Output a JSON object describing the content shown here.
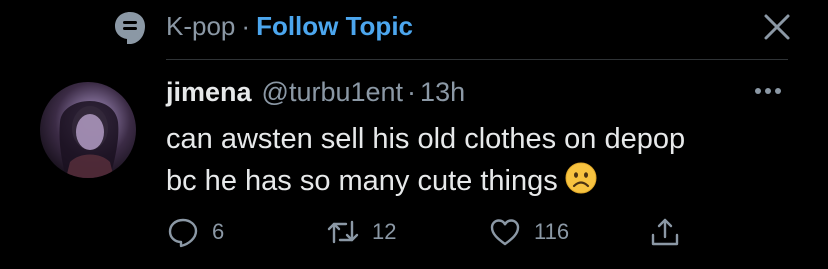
{
  "topic": {
    "name": "K-pop",
    "separator": "·",
    "follow_label": "Follow Topic",
    "icon": "topic-icon"
  },
  "tweet": {
    "display_name": "jimena",
    "handle": "@turbu1ent",
    "separator": "·",
    "time": "13h",
    "text_line1": "can awsten sell his old clothes on depop",
    "text_line2": "bc he has so many cute things",
    "emoji": "frowning-face"
  },
  "actions": {
    "reply_count": "6",
    "retweet_count": "12",
    "like_count": "116"
  },
  "colors": {
    "background": "#000000",
    "primary_text": "#e7e9ea",
    "secondary_text": "#8b98a5",
    "accent": "#4ca6ee",
    "divider": "#2f3336"
  }
}
